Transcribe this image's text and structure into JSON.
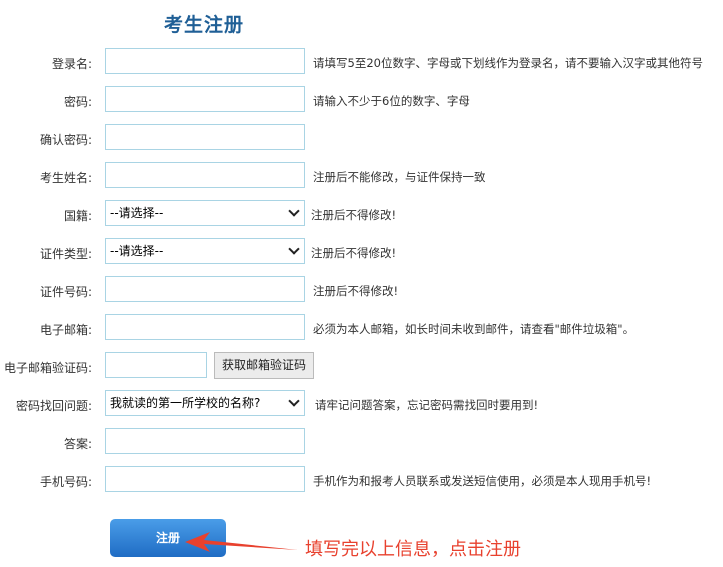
{
  "title": "考生注册",
  "fields": [
    {
      "label": "登录名:",
      "hint": "请填写5至20位数字、字母或下划线作为登录名，请不要输入汉字或其他符号"
    },
    {
      "label": "密码:",
      "hint": "请输入不少于6位的数字、字母"
    },
    {
      "label": "确认密码:",
      "hint": ""
    },
    {
      "label": "考生姓名:",
      "hint": "注册后不能修改，与证件保持一致"
    },
    {
      "label": "国籍:",
      "select": "--请选择--",
      "hint": "注册后不得修改!"
    },
    {
      "label": "证件类型:",
      "select": "--请选择--",
      "hint": "注册后不得修改!"
    },
    {
      "label": "证件号码:",
      "hint": "注册后不得修改!"
    },
    {
      "label": "电子邮箱:",
      "hint": "必须为本人邮箱，如长时间未收到邮件，请查看\"邮件垃圾箱\"。"
    },
    {
      "label": "电子邮箱验证码:",
      "button": "获取邮箱验证码"
    },
    {
      "label": "密码找回问题:",
      "select": "我就读的第一所学校的名称?",
      "hint": "请牢记问题答案，忘记密码需找回时要用到!"
    },
    {
      "label": "答案:",
      "hint": ""
    },
    {
      "label": "手机号码:",
      "hint": "手机作为和报考人员联系或发送短信使用，必须是本人现用手机号!"
    }
  ],
  "submit_label": "注册",
  "annotation": "填写完以上信息，点击注册",
  "colors": {
    "title": "#1f5f96",
    "input_border": "#a9d4e4",
    "button": "#2a7dd6",
    "annotation": "#e8412e"
  }
}
